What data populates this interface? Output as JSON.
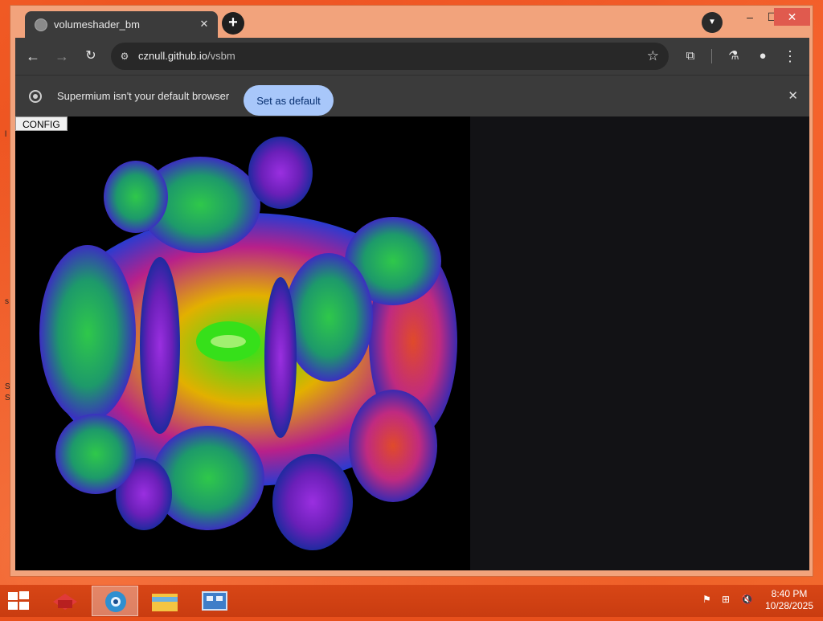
{
  "browser": {
    "tab": {
      "title": "volumeshader_bm"
    },
    "address": {
      "host": "cznull.github.io",
      "path": "/vsbm"
    },
    "infobar": {
      "message": "Supermium isn't your default browser",
      "button": "Set as default"
    }
  },
  "page": {
    "config_button": "CONFIG"
  },
  "taskbar": {
    "time": "8:40 PM",
    "date": "10/28/2025"
  },
  "colors": {
    "window_frame": "#f2a37c",
    "toolbar": "#3b3b3b",
    "accent_button": "#a8c7fa",
    "close_button": "#e05a4e",
    "taskbar": "#d84616"
  }
}
